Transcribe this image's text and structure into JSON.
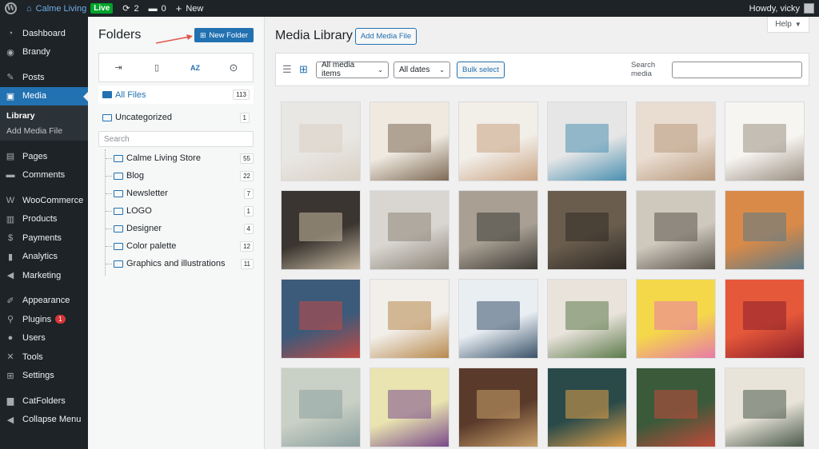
{
  "adminbar": {
    "site_name": "Calme Living",
    "live": "Live",
    "updates": "2",
    "comments": "0",
    "new_label": "New",
    "howdy": "Howdy, vicky"
  },
  "sidebar": {
    "items": [
      {
        "label": "Dashboard",
        "icon": "dashboard-icon",
        "glyph": "◔"
      },
      {
        "label": "Brandy",
        "icon": "brandy-icon",
        "glyph": "◉"
      },
      {
        "label": "Posts",
        "icon": "pin-icon",
        "glyph": "✎"
      },
      {
        "label": "Media",
        "icon": "media-icon",
        "glyph": "▣"
      },
      {
        "label": "Pages",
        "icon": "pages-icon",
        "glyph": "▤"
      },
      {
        "label": "Comments",
        "icon": "comments-icon",
        "glyph": "▬"
      },
      {
        "label": "WooCommerce",
        "icon": "woocommerce-icon",
        "glyph": "W"
      },
      {
        "label": "Products",
        "icon": "products-icon",
        "glyph": "▥"
      },
      {
        "label": "Payments",
        "icon": "payments-icon",
        "glyph": "$"
      },
      {
        "label": "Analytics",
        "icon": "analytics-icon",
        "glyph": "▮"
      },
      {
        "label": "Marketing",
        "icon": "marketing-icon",
        "glyph": "◀"
      },
      {
        "label": "Appearance",
        "icon": "appearance-icon",
        "glyph": "✐"
      },
      {
        "label": "Plugins",
        "icon": "plugins-icon",
        "glyph": "⚲",
        "badge": "1"
      },
      {
        "label": "Users",
        "icon": "users-icon",
        "glyph": "●"
      },
      {
        "label": "Tools",
        "icon": "tools-icon",
        "glyph": "✕"
      },
      {
        "label": "Settings",
        "icon": "settings-icon",
        "glyph": "⊞"
      },
      {
        "label": "CatFolders",
        "icon": "catfolders-icon",
        "glyph": "▆"
      },
      {
        "label": "Collapse Menu",
        "icon": "collapse-icon",
        "glyph": "◀"
      }
    ],
    "submenu": [
      "Library",
      "Add Media File"
    ]
  },
  "folders": {
    "title": "Folders",
    "new_folder": "New Folder",
    "sort_label": "AZ",
    "all_files": {
      "label": "All Files",
      "count": "113"
    },
    "uncategorized": {
      "label": "Uncategorized",
      "count": "1"
    },
    "search_placeholder": "Search",
    "tree": [
      {
        "label": "Calme Living Store",
        "count": "55"
      },
      {
        "label": "Blog",
        "count": "22"
      },
      {
        "label": "Newsletter",
        "count": "7"
      },
      {
        "label": "LOGO",
        "count": "1"
      },
      {
        "label": "Designer",
        "count": "4"
      },
      {
        "label": "Color palette",
        "count": "12"
      },
      {
        "label": "Graphics and illustrations",
        "count": "11"
      }
    ]
  },
  "main": {
    "title": "Media Library",
    "add_media": "Add Media File",
    "help": "Help",
    "filter_type": "All media items",
    "filter_date": "All dates",
    "bulk_select": "Bulk select",
    "search_label": "Search media"
  },
  "thumbs": [
    [
      "#e9e7e4",
      "#d8cfc3"
    ],
    [
      "#efe9e0",
      "#7d6a55"
    ],
    [
      "#f2eee8",
      "#c9a483"
    ],
    [
      "#e6e6e6",
      "#4a8fb0"
    ],
    [
      "#e9dcd0",
      "#b89a7e"
    ],
    [
      "#f7f5f1",
      "#9b8f82"
    ],
    [
      "#3a3530",
      "#c8b9a3"
    ],
    [
      "#d9d6d1",
      "#8c8579"
    ],
    [
      "#a9a093",
      "#3d3a35"
    ],
    [
      "#6a5d4e",
      "#2f2a25"
    ],
    [
      "#cfc8bd",
      "#5c564d"
    ],
    [
      "#d98a48",
      "#5a7a8a"
    ],
    [
      "#3c5a7a",
      "#c24a43"
    ],
    [
      "#f2efea",
      "#b8894e"
    ],
    [
      "#e9eef3",
      "#3a5269"
    ],
    [
      "#e9e3dc",
      "#5c7a4a"
    ],
    [
      "#f5d84a",
      "#e87aa8"
    ],
    [
      "#e6583a",
      "#8a1f2a"
    ],
    [
      "#c9d0c5",
      "#8ca0a0"
    ],
    [
      "#e9e4b0",
      "#7a4a8a"
    ],
    [
      "#5a3a2a",
      "#c9a06a"
    ],
    [
      "#2a4a4a",
      "#e0a04a"
    ],
    [
      "#3a5a3a",
      "#c24a3a"
    ],
    [
      "#e9e4da",
      "#4a5a4a"
    ]
  ]
}
